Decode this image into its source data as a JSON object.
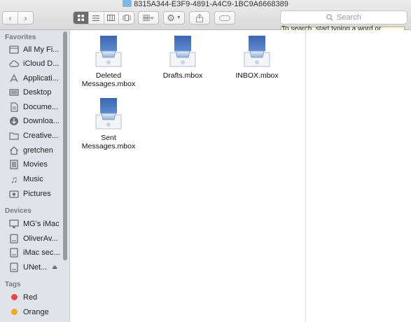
{
  "window": {
    "title": "8315A344-E3F9-4891-A4C9-1BC9A6668389"
  },
  "toolbar": {
    "back_icon": "chevron-left-icon",
    "forward_icon": "chevron-right-icon",
    "view_icons": [
      "icon-view-icon",
      "list-view-icon",
      "column-view-icon",
      "coverflow-view-icon"
    ],
    "arrange_icon": "arrange-grid-icon",
    "action_icon": "gear-icon",
    "share_icon": "share-icon",
    "tag_icon": "tag-icon",
    "search": {
      "placeholder": "Search",
      "tooltip": "To search, start typing a word or phrase"
    }
  },
  "sidebar": {
    "favorites_header": "Favorites",
    "favorites": [
      {
        "label": "All My Fi...",
        "icon": "all-my-files-icon"
      },
      {
        "label": "iCloud D...",
        "icon": "cloud-icon"
      },
      {
        "label": "Applicati...",
        "icon": "applications-icon"
      },
      {
        "label": "Desktop",
        "icon": "desktop-icon"
      },
      {
        "label": "Docume...",
        "icon": "documents-icon"
      },
      {
        "label": "Downloa...",
        "icon": "downloads-icon"
      },
      {
        "label": "Creative...",
        "icon": "folder-icon"
      },
      {
        "label": "gretchen",
        "icon": "home-icon"
      },
      {
        "label": "Movies",
        "icon": "movies-icon"
      },
      {
        "label": "Music",
        "icon": "music-icon"
      },
      {
        "label": "Pictures",
        "icon": "pictures-icon"
      }
    ],
    "devices_header": "Devices",
    "devices": [
      {
        "label": "MG's iMac",
        "icon": "imac-icon"
      },
      {
        "label": "OliverAv...",
        "icon": "disk-icon"
      },
      {
        "label": "iMac sec...",
        "icon": "disk-icon"
      },
      {
        "label": "UNet...",
        "icon": "disk-icon",
        "eject": "⏏"
      }
    ],
    "tags_header": "Tags",
    "tags": [
      {
        "label": "Red",
        "color": "#e8474a"
      },
      {
        "label": "Orange",
        "color": "#f5a623"
      }
    ]
  },
  "files": [
    {
      "label": "Deleted Messages.mbox"
    },
    {
      "label": "Drafts.mbox"
    },
    {
      "label": "INBOX.mbox"
    },
    {
      "label": "Sent Messages.mbox"
    }
  ]
}
